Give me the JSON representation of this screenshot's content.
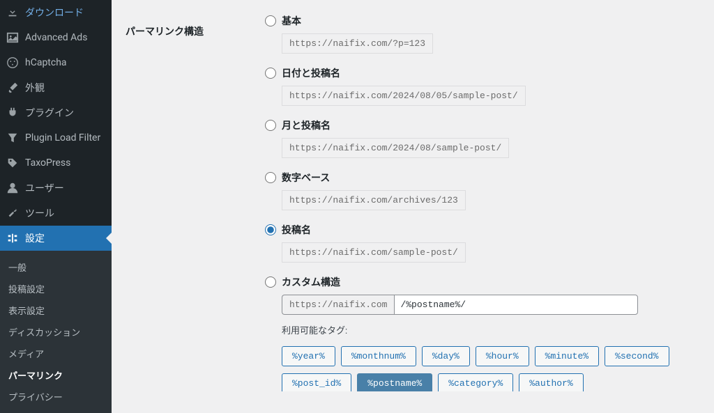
{
  "sidebar": {
    "items": [
      {
        "label": "ダウンロード",
        "icon": "download"
      },
      {
        "label": "Advanced Ads",
        "icon": "image"
      },
      {
        "label": "hCaptcha",
        "icon": "captcha"
      },
      {
        "label": "外観",
        "icon": "brush"
      },
      {
        "label": "プラグイン",
        "icon": "plug"
      },
      {
        "label": "Plugin Load Filter",
        "icon": "filter"
      },
      {
        "label": "TaxoPress",
        "icon": "tag"
      },
      {
        "label": "ユーザー",
        "icon": "user"
      },
      {
        "label": "ツール",
        "icon": "wrench"
      },
      {
        "label": "設定",
        "icon": "settings"
      }
    ],
    "submenu": [
      {
        "label": "一般"
      },
      {
        "label": "投稿設定"
      },
      {
        "label": "表示設定"
      },
      {
        "label": "ディスカッション"
      },
      {
        "label": "メディア"
      },
      {
        "label": "パーマリンク",
        "active": true
      },
      {
        "label": "プライバシー"
      }
    ]
  },
  "page": {
    "section_label": "パーマリンク構造"
  },
  "permalink_options": [
    {
      "label": "基本",
      "example": "https://naifix.com/?p=123",
      "selected": false
    },
    {
      "label": "日付と投稿名",
      "example": "https://naifix.com/2024/08/05/sample-post/",
      "selected": false
    },
    {
      "label": "月と投稿名",
      "example": "https://naifix.com/2024/08/sample-post/",
      "selected": false
    },
    {
      "label": "数字ベース",
      "example": "https://naifix.com/archives/123",
      "selected": false
    },
    {
      "label": "投稿名",
      "example": "https://naifix.com/sample-post/",
      "selected": true
    },
    {
      "label": "カスタム構造",
      "custom": true
    }
  ],
  "custom": {
    "prefix": "https://naifix.com",
    "value": "/%postname%/",
    "tags_label": "利用可能なタグ:"
  },
  "tags_row1": [
    "%year%",
    "%monthnum%",
    "%day%",
    "%hour%",
    "%minute%",
    "%second%"
  ],
  "tags_row2": [
    {
      "label": "%post_id%",
      "active": false
    },
    {
      "label": "%postname%",
      "active": true
    },
    {
      "label": "%category%",
      "active": false
    },
    {
      "label": "%author%",
      "active": false
    }
  ]
}
